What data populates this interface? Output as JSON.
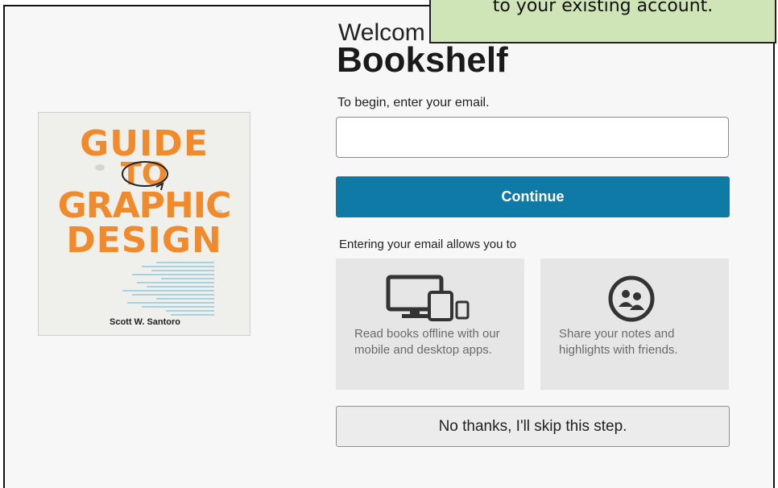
{
  "callout": {
    "text": "to your existing account."
  },
  "header": {
    "welcome": "Welcom",
    "brand": "Bookshelf"
  },
  "book": {
    "title_lines": [
      "GUIDE",
      "TO",
      "GRAPHIC",
      "DESIGN"
    ],
    "author": "Scott W. Santoro",
    "accent_color": "#f08a2b"
  },
  "form": {
    "prompt": "To begin, enter your email.",
    "email_value": "",
    "email_placeholder": "",
    "continue_label": "Continue",
    "accent_color": "#0f7aa6"
  },
  "benefits": {
    "heading": "Entering your email allows you to",
    "cards": [
      {
        "icon": "devices-icon",
        "text": "Read books offline with our mobile and desktop apps."
      },
      {
        "icon": "share-people-icon",
        "text": "Share your notes and highlights with friends."
      }
    ]
  },
  "skip_label": "No thanks, I'll skip this step."
}
